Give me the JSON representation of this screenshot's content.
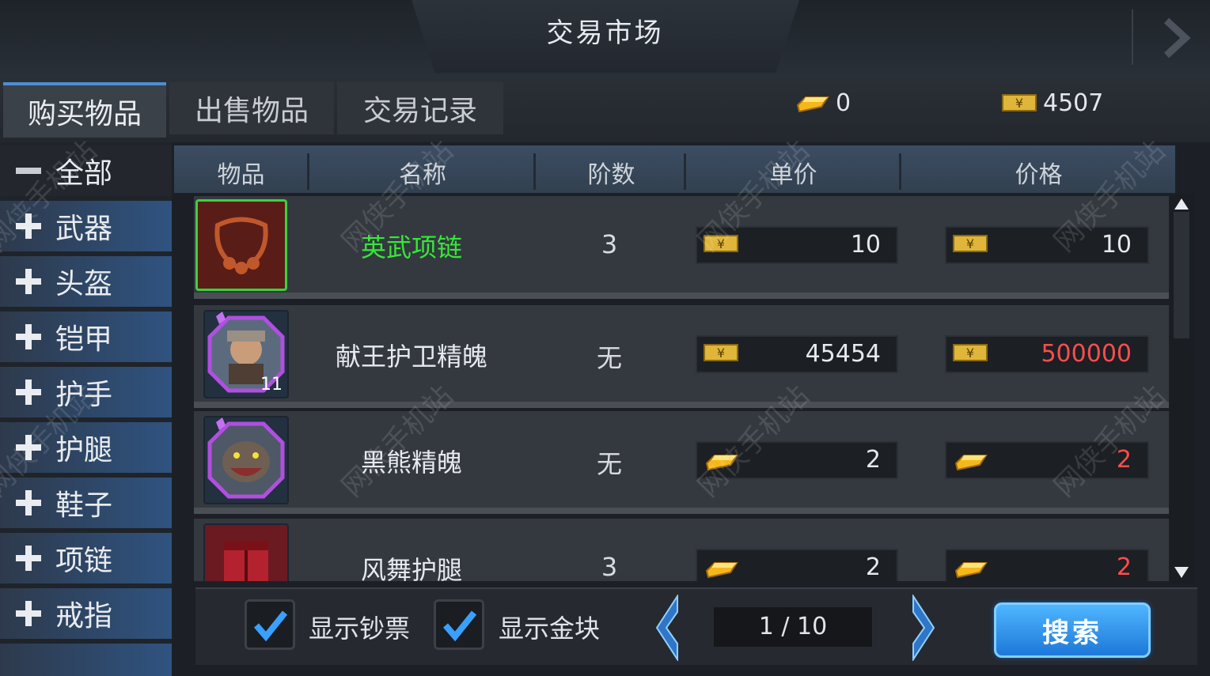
{
  "title": "交易市场",
  "tabs": [
    "购买物品",
    "出售物品",
    "交易记录"
  ],
  "currency": {
    "gold": "0",
    "notes": "4507"
  },
  "categories": [
    "全部",
    "武器",
    "头盔",
    "铠甲",
    "护手",
    "护腿",
    "鞋子",
    "项链",
    "戒指"
  ],
  "columns": [
    "物品",
    "名称",
    "阶数",
    "单价",
    "价格"
  ],
  "rows": [
    {
      "name": "英武项链",
      "name_color": "#35e836",
      "level": "3",
      "unit_price": "10",
      "price": "10",
      "price_color": "#e6e9ee",
      "currency_icon": "note-icon",
      "thumb_color": "#5a1c17",
      "count": ""
    },
    {
      "name": "献王护卫精魄",
      "name_color": "#e6e9ee",
      "level": "无",
      "unit_price": "45454",
      "price": "500000",
      "price_color": "#ff4d4d",
      "currency_icon": "note-icon",
      "thumb_color": "#2b2f3a",
      "count": "11"
    },
    {
      "name": "黑熊精魄",
      "name_color": "#e6e9ee",
      "level": "无",
      "unit_price": "2",
      "price": "2",
      "price_color": "#ff4d4d",
      "currency_icon": "gold-bar-icon",
      "thumb_color": "#2b2f3a",
      "count": ""
    },
    {
      "name": "风舞护腿",
      "name_color": "#e6e9ee",
      "level": "3",
      "unit_price": "2",
      "price": "2",
      "price_color": "#ff4d4d",
      "currency_icon": "gold-bar-icon",
      "thumb_color": "#6b1a22",
      "count": ""
    }
  ],
  "footer": {
    "show_notes": "显示钞票",
    "show_gold": "显示金块",
    "page": "1 / 10",
    "search": "搜索"
  },
  "watermark": "网侠手机站"
}
